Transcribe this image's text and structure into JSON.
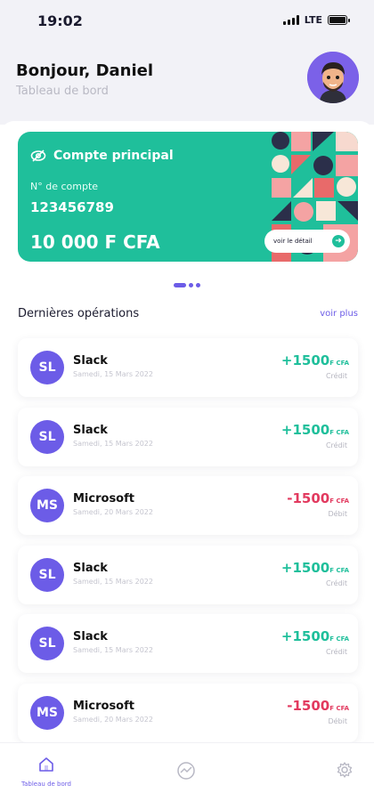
{
  "status_bar": {
    "time": "19:02",
    "network": "LTE"
  },
  "header": {
    "greeting": "Bonjour, Daniel",
    "subtitle": "Tableau de bord"
  },
  "account_card": {
    "title": "Compte principal",
    "account_label": "N° de compte",
    "account_number": "123456789",
    "balance": "10 000 F CFA",
    "detail_button": "voir le détail",
    "color": "#1fbf9b"
  },
  "operations_section": {
    "title": "Dernières opérations",
    "see_more": "voir plus"
  },
  "operations": [
    {
      "initials": "SL",
      "name": "Slack",
      "date": "Samedi, 15 Mars 2022",
      "amount": "+1500",
      "currency": "F CFA",
      "type": "Crédit",
      "kind": "credit"
    },
    {
      "initials": "SL",
      "name": "Slack",
      "date": "Samedi, 15 Mars 2022",
      "amount": "+1500",
      "currency": "F CFA",
      "type": "Crédit",
      "kind": "credit"
    },
    {
      "initials": "MS",
      "name": "Microsoft",
      "date": "Samedi, 20 Mars 2022",
      "amount": "-1500",
      "currency": "F CFA",
      "type": "Débit",
      "kind": "debit"
    },
    {
      "initials": "SL",
      "name": "Slack",
      "date": "Samedi, 15 Mars 2022",
      "amount": "+1500",
      "currency": "F CFA",
      "type": "Crédit",
      "kind": "credit"
    },
    {
      "initials": "SL",
      "name": "Slack",
      "date": "Samedi, 15 Mars 2022",
      "amount": "+1500",
      "currency": "F CFA",
      "type": "Crédit",
      "kind": "credit"
    },
    {
      "initials": "MS",
      "name": "Microsoft",
      "date": "Samedi, 20 Mars 2022",
      "amount": "-1500",
      "currency": "F CFA",
      "type": "Débit",
      "kind": "debit"
    }
  ],
  "bottom_nav": [
    {
      "icon": "home-icon",
      "label": "Tableau de bord",
      "active": true
    },
    {
      "icon": "chart-icon",
      "active": false
    },
    {
      "icon": "gear-icon",
      "active": false
    }
  ],
  "colors": {
    "accent": "#6c5ce7",
    "credit": "#1fbf9b",
    "debit": "#e23a5f"
  }
}
